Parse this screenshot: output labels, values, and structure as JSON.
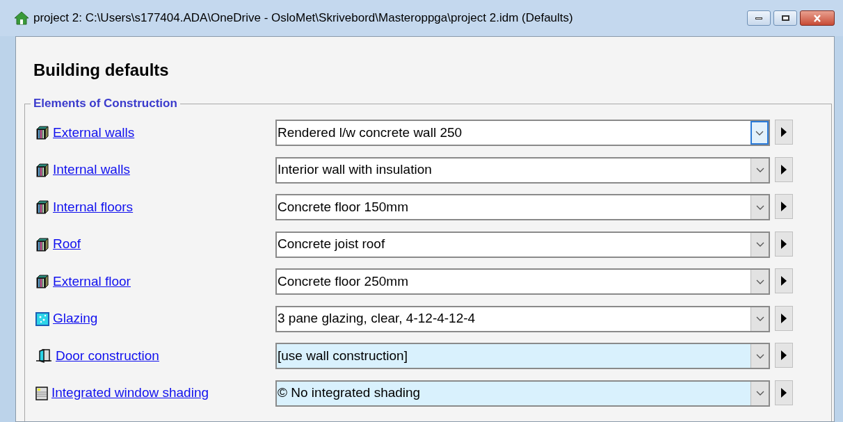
{
  "window": {
    "title": "project 2: C:\\Users\\s177404.ADA\\OneDrive - OsloMet\\Skrivebord\\Masteroppga\\project 2.idm (Defaults)"
  },
  "heading": "Building defaults",
  "group": {
    "title": "Elements of Construction",
    "rows": [
      {
        "kind": "construction",
        "label": "External walls",
        "value": "Rendered l/w concrete wall 250",
        "inherited": false,
        "focused": true
      },
      {
        "kind": "construction",
        "label": "Internal walls",
        "value": "Interior wall with insulation",
        "inherited": false,
        "focused": false
      },
      {
        "kind": "construction",
        "label": "Internal floors",
        "value": "Concrete floor 150mm",
        "inherited": false,
        "focused": false
      },
      {
        "kind": "construction",
        "label": "Roof",
        "value": "Concrete joist roof",
        "inherited": false,
        "focused": false
      },
      {
        "kind": "construction",
        "label": "External floor",
        "value": "Concrete floor 250mm",
        "inherited": false,
        "focused": false
      },
      {
        "kind": "glazing",
        "label": "Glazing",
        "value": "3 pane glazing, clear, 4-12-4-12-4",
        "inherited": false,
        "focused": false
      },
      {
        "kind": "door",
        "label": "Door construction",
        "value": "[use wall construction]",
        "inherited": true,
        "focused": false
      },
      {
        "kind": "shading",
        "label": "Integrated window shading",
        "value": "© No integrated shading",
        "inherited": true,
        "focused": false
      }
    ]
  }
}
